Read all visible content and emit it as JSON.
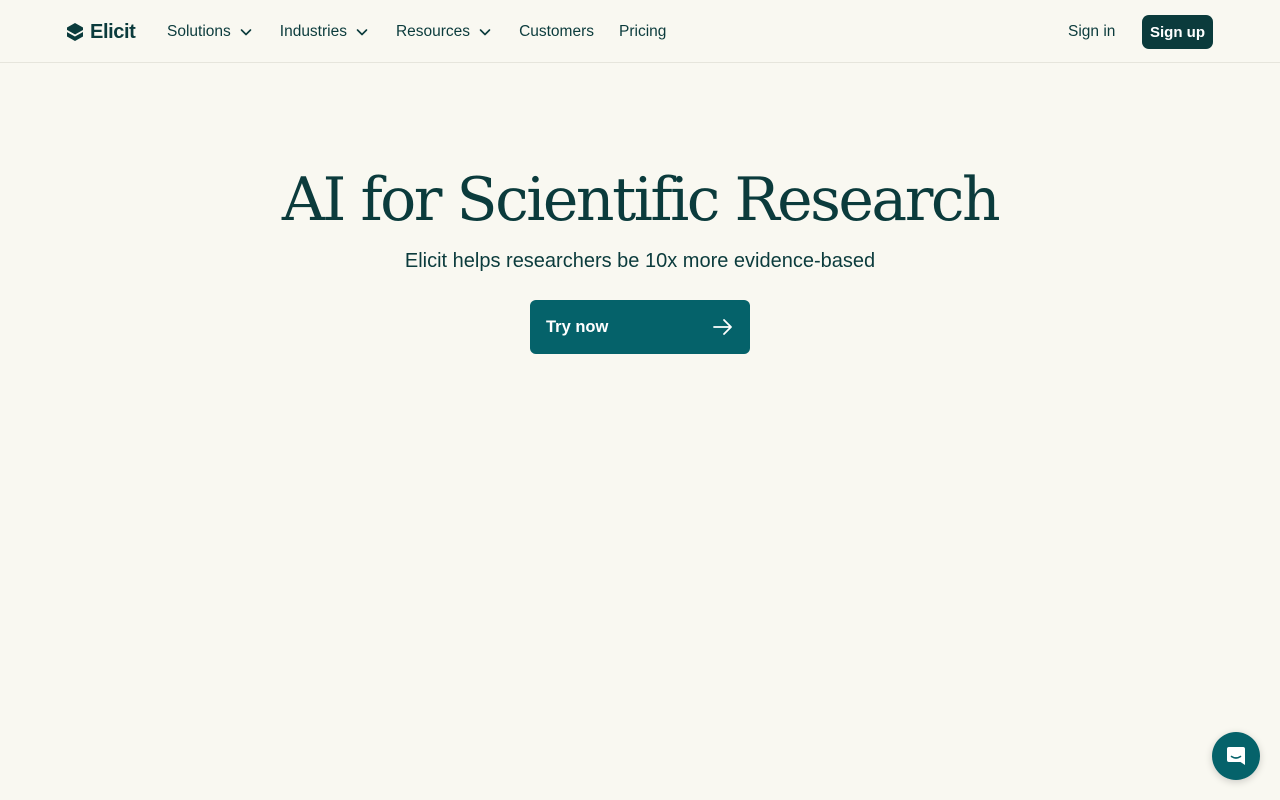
{
  "brand": {
    "name": "Elicit",
    "logo_icon": "elicit-logo-icon"
  },
  "nav": {
    "items": [
      {
        "label": "Solutions",
        "has_dropdown": true,
        "icon": "chevron-down-icon"
      },
      {
        "label": "Industries",
        "has_dropdown": true,
        "icon": "chevron-down-icon"
      },
      {
        "label": "Resources",
        "has_dropdown": true,
        "icon": "chevron-down-icon"
      },
      {
        "label": "Customers",
        "has_dropdown": false
      },
      {
        "label": "Pricing",
        "has_dropdown": false
      }
    ]
  },
  "auth": {
    "sign_in_label": "Sign in",
    "sign_up_label": "Sign up"
  },
  "hero": {
    "title": "AI for Scientific Research",
    "subtitle": "Elicit helps researchers be 10x more evidence-based",
    "cta_label": "Try now",
    "cta_icon": "arrow-right-icon"
  },
  "chat_widget": {
    "icon": "chat-bubble-icon"
  },
  "colors": {
    "background": "#f9f8f1",
    "text": "#0b3b3c",
    "primary_dark": "#0b3b3c",
    "cta": "#05626a",
    "divider": "#e6e5dc"
  }
}
